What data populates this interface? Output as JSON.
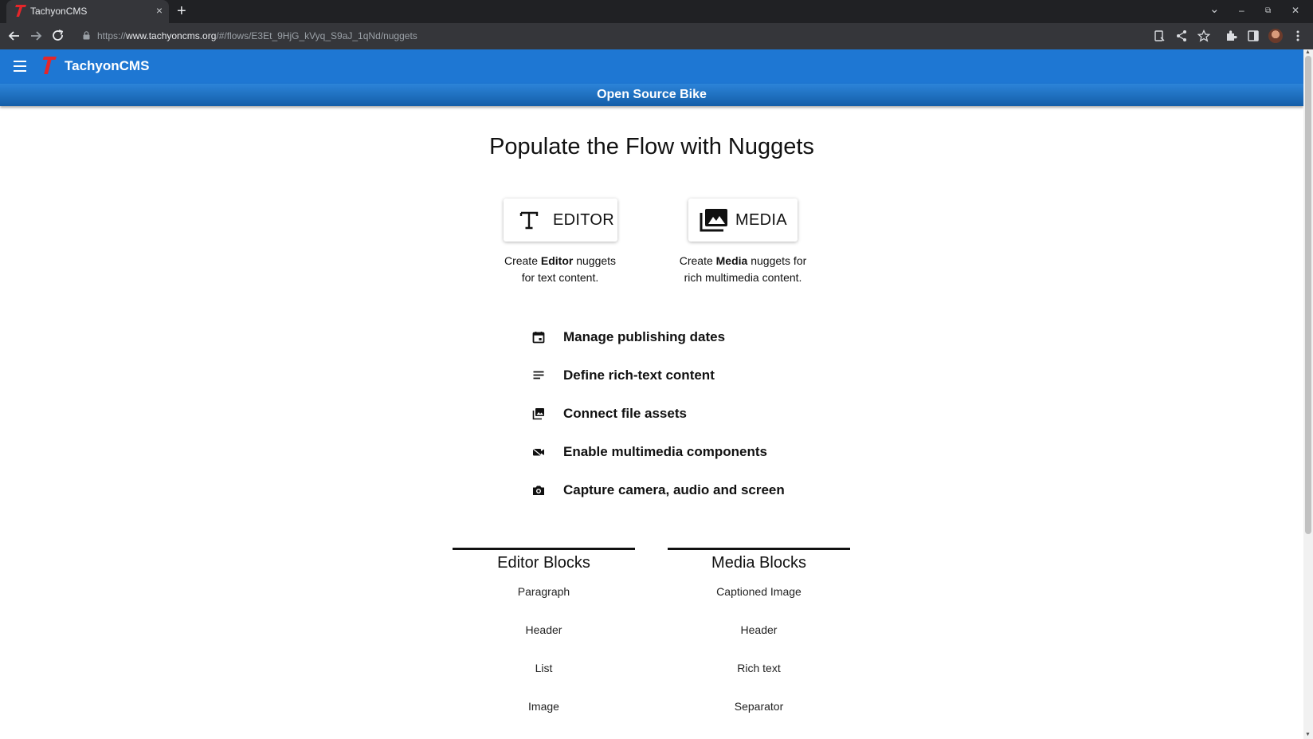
{
  "browser": {
    "tab_title": "TachyonCMS",
    "tab_close": "×",
    "new_tab": "+",
    "url_scheme": "https://",
    "url_host": "www.tachyoncms.org",
    "url_path": "/#/flows/E3Et_9HjG_kVyq_S9aJ_1qNd/nuggets",
    "win_minimize": "–",
    "win_restore": "⧉",
    "win_close": "✕",
    "tab_list": "⌄"
  },
  "app": {
    "brand": "TachyonCMS",
    "flow_title": "Open Source Bike",
    "brand_color": "#1e77d3",
    "logo_color": "#e5262a"
  },
  "main": {
    "heading": "Populate the Flow with Nuggets",
    "editor": {
      "label": "EDITOR",
      "desc_prefix": "Create ",
      "desc_bold": "Editor",
      "desc_suffix": " nuggets",
      "desc_line2": "for text content."
    },
    "media": {
      "label": "MEDIA",
      "desc_prefix": "Create ",
      "desc_bold": "Media",
      "desc_suffix": " nuggets for",
      "desc_line2": "rich multimedia content."
    },
    "features": [
      {
        "icon": "calendar-icon",
        "text": "Manage publishing dates"
      },
      {
        "icon": "text-lines-icon",
        "text": "Define rich-text content"
      },
      {
        "icon": "photo-library-icon",
        "text": "Connect file assets"
      },
      {
        "icon": "video-camera-icon",
        "text": "Enable multimedia components"
      },
      {
        "icon": "camera-icon",
        "text": "Capture camera, audio and screen"
      }
    ]
  },
  "blocks": {
    "editor": {
      "title": "Editor Blocks",
      "items": [
        "Paragraph",
        "Header",
        "List",
        "Image"
      ]
    },
    "media": {
      "title": "Media Blocks",
      "items": [
        "Captioned Image",
        "Header",
        "Rich text",
        "Separator"
      ]
    }
  }
}
